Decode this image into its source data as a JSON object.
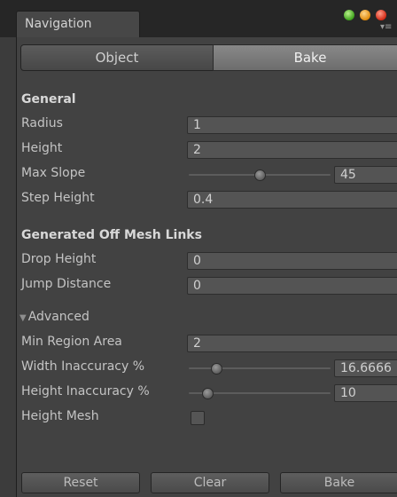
{
  "window": {
    "tab_title": "Navigation",
    "controls": [
      "green-dot-icon",
      "orange-dot-icon",
      "red-dot-icon",
      "panel-menu-icon"
    ]
  },
  "modes": {
    "object": "Object",
    "bake": "Bake",
    "selected": "Bake"
  },
  "general": {
    "heading": "General",
    "radius_label": "Radius",
    "radius_value": "1",
    "height_label": "Height",
    "height_value": "2",
    "max_slope_label": "Max Slope",
    "max_slope_value": "45",
    "max_slope_level": 0.5,
    "step_height_label": "Step Height",
    "step_height_value": "0.4"
  },
  "offmesh": {
    "heading": "Generated Off Mesh Links",
    "drop_height_label": "Drop Height",
    "drop_height_value": "0",
    "jump_distance_label": "Jump Distance",
    "jump_distance_value": "0"
  },
  "advanced": {
    "label": "Advanced",
    "arrow": "▼",
    "min_region_label": "Min Region Area",
    "min_region_value": "2",
    "width_inacc_label": "Width Inaccuracy %",
    "width_inacc_value": "16.6666",
    "width_inacc_level": 0.17,
    "height_inacc_label": "Height Inaccuracy %",
    "height_inacc_value": "10",
    "height_inacc_level": 0.1,
    "height_mesh_label": "Height Mesh",
    "height_mesh_checked": false
  },
  "buttons": {
    "reset": "Reset",
    "clear": "Clear",
    "bake": "Bake"
  }
}
